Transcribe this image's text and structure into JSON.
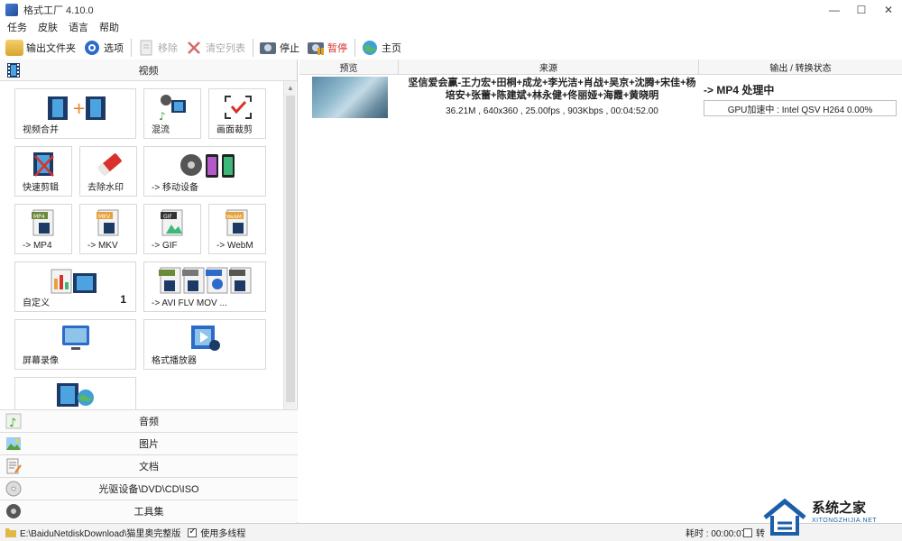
{
  "window": {
    "title": "格式工厂 4.10.0",
    "controls": [
      "—",
      "☐",
      "✕"
    ]
  },
  "menu": [
    "任务",
    "皮肤",
    "语言",
    "帮助"
  ],
  "toolbar": {
    "output_folder": "输出文件夹",
    "options": "选项",
    "remove": "移除",
    "clear_list": "清空列表",
    "stop": "停止",
    "pause": "暂停",
    "home": "主页"
  },
  "left": {
    "video_header": "视频",
    "tiles": [
      {
        "label": "视频合并"
      },
      {
        "label": "混流"
      },
      {
        "label": "画面裁剪"
      },
      {
        "label": "快速剪辑"
      },
      {
        "label": "去除水印"
      },
      {
        "label": "-> 移动设备"
      },
      {
        "label": "-> MP4"
      },
      {
        "label": "-> MKV"
      },
      {
        "label": "-> GIF"
      },
      {
        "label": "-> WebM"
      },
      {
        "label": "自定义",
        "badge": "1"
      },
      {
        "label": "-> AVI FLV MOV ..."
      },
      {
        "label": "屏幕录像"
      },
      {
        "label": "格式播放器"
      },
      {
        "label": ""
      }
    ],
    "categories": [
      "音频",
      "图片",
      "文档",
      "光驱设备\\DVD\\CD\\ISO",
      "工具集"
    ]
  },
  "table": {
    "headers": [
      "预览",
      "来源",
      "输出 / 转换状态"
    ],
    "row": {
      "title": "坚信爱会赢-王力宏+田桐+成龙+李光洁+肖战+吴京+沈腾+宋佳+杨培安+张蕾+陈建斌+林永健+佟丽娅+海霞+黄晓明",
      "meta": "36.21M , 640x360 , 25.00fps , 903Kbps , 00:04:52.00",
      "status": "-> MP4 处理中",
      "gpu": "GPU加速中 : Intel QSV H264 0.00%"
    }
  },
  "statusbar": {
    "path": "E:\\BaiduNetdiskDownload\\猫里奥完整版",
    "multithread": "使用多线程",
    "elapsed": "耗时 : 00:00:07",
    "after": "转"
  },
  "watermark": {
    "title": "系统之家",
    "sub": "XITONGZHIJIA.NET"
  },
  "colors": {
    "accent_red": "#d8322b",
    "watermark_blue": "#1a5fa8"
  }
}
